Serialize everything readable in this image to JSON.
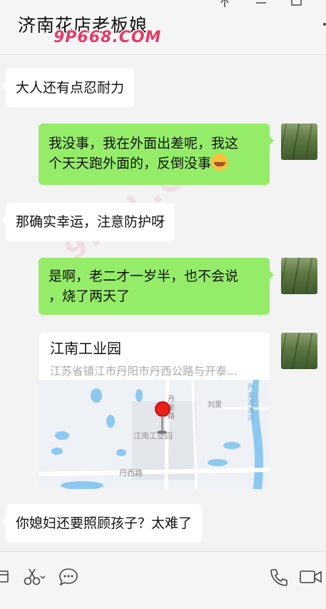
{
  "header": {
    "title": "济南花店老板娘",
    "watermark": "9P668.COM"
  },
  "watermark_diag": "9POL.COM",
  "messages": [
    {
      "side": "left",
      "text": "大人还有点忍耐力"
    },
    {
      "side": "right",
      "line1": "我没事，我在外面出差呢，我这",
      "line2": "个天天跑外面的，反倒没事"
    },
    {
      "side": "left",
      "text": "那确实幸运，注意防护呀"
    },
    {
      "side": "right",
      "line1": "是啊，老二才一岁半，也不会说",
      "line2": "，烧了两天了"
    },
    {
      "side": "left",
      "text": "你媳妇还要照顾孩子？太难了"
    }
  ],
  "location": {
    "title": "江南工业园",
    "address": "江苏省镇江市丹阳市丹西公路与开泰...",
    "map_labels": {
      "road_vertical": "丹金路",
      "village": "刘里",
      "park": "江南工业园",
      "road_horizontal": "丹西路",
      "river": "丹金溧漕河"
    }
  },
  "icons": {
    "pin": "pin-icon",
    "minimize": "minimize-icon",
    "maximize": "maximize-icon",
    "more": "more-icon",
    "file": "folder-icon",
    "scissors": "scissors-icon",
    "chat": "chat-bubble-icon",
    "phone": "phone-icon",
    "video": "video-icon"
  },
  "colors": {
    "bubble_right": "#95ec69",
    "bubble_left": "#ffffff",
    "background": "#f3f3f3"
  }
}
